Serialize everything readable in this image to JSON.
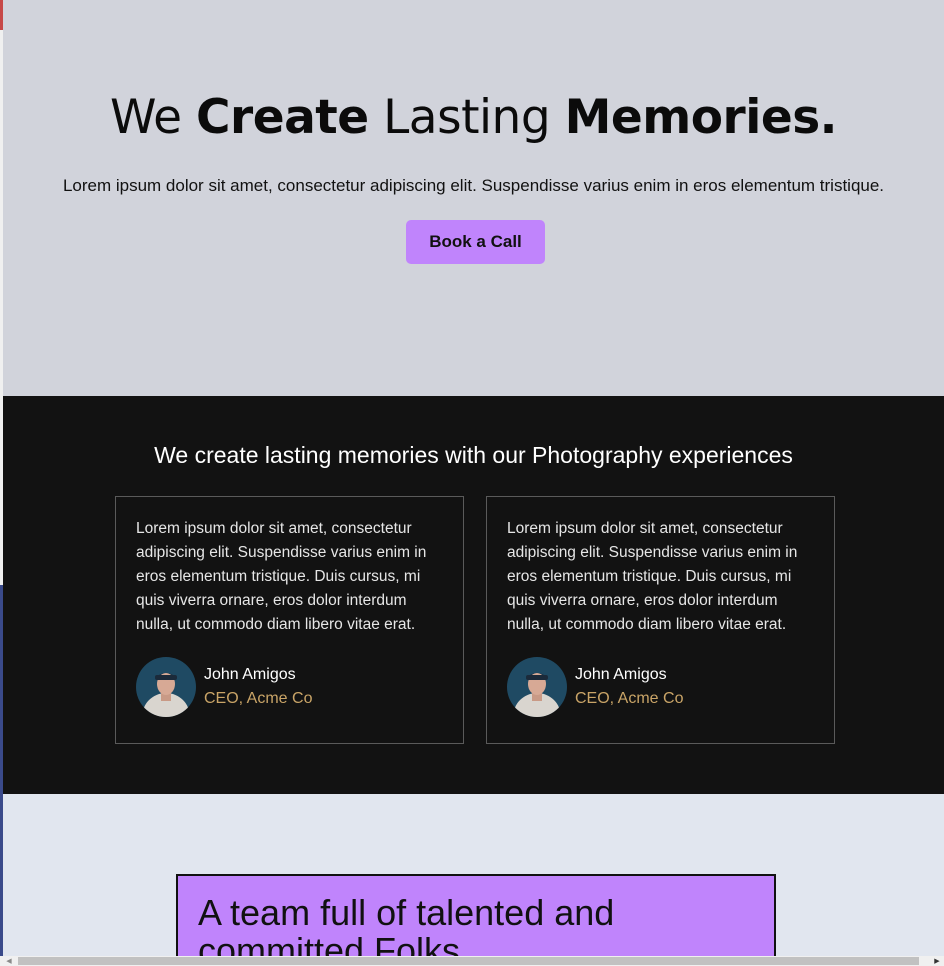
{
  "hero": {
    "title_part1": "We ",
    "title_part2": "Create",
    "title_part3": " Lasting ",
    "title_part4": "Memories.",
    "subtitle": "Lorem ipsum dolor sit amet, consectetur adipiscing elit. Suspendisse varius enim in eros elementum tristique.",
    "cta_label": "Book a Call",
    "accent_color": "#c084fc",
    "background_color": "#d1d3db"
  },
  "testimonials": {
    "title": "We create lasting memories with our Photography experiences",
    "background_color": "#121212",
    "items": [
      {
        "quote": "Lorem ipsum dolor sit amet, consectetur adipiscing elit. Suspendisse varius enim in eros elementum tristique. Duis cursus, mi quis viverra ornare, eros dolor interdum nulla, ut commodo diam libero vitae erat.",
        "name": "John Amigos",
        "role": "CEO, Acme Co",
        "avatar_icon": "person-avatar"
      },
      {
        "quote": "Lorem ipsum dolor sit amet, consectetur adipiscing elit. Suspendisse varius enim in eros elementum tristique. Duis cursus, mi quis viverra ornare, eros dolor interdum nulla, ut commodo diam libero vitae erat.",
        "name": "John Amigos",
        "role": "CEO, Acme Co",
        "avatar_icon": "person-avatar"
      }
    ],
    "role_color": "#c9a467"
  },
  "team": {
    "title": "A team full of talented and committed Folks",
    "background_color": "#e1e6ef",
    "box_color": "#c084fc"
  },
  "scrollbar": {
    "left_arrow_icon": "chevron-left-icon",
    "right_arrow_icon": "chevron-right-icon"
  }
}
